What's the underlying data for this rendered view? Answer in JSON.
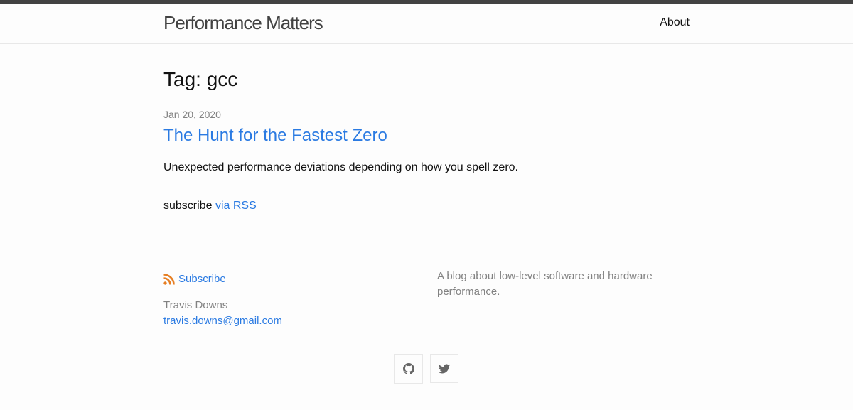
{
  "header": {
    "site_title": "Performance Matters",
    "nav_about": "About"
  },
  "main": {
    "page_heading": "Tag: gcc",
    "post": {
      "date": "Jan 20, 2020",
      "title": "The Hunt for the Fastest Zero",
      "excerpt": "Unexpected performance deviations depending on how you spell zero."
    },
    "subscribe_prefix": "subscribe",
    "subscribe_link": "via RSS"
  },
  "footer": {
    "subscribe_label": "Subscribe",
    "author_name": "Travis Downs",
    "author_email": "travis.downs@gmail.com",
    "description": "A blog about low-level software and hardware performance.",
    "social": [
      {
        "icon": "github-icon"
      },
      {
        "icon": "twitter-icon"
      }
    ]
  },
  "colors": {
    "link": "#2a7ae2",
    "rss": "#e67e22",
    "muted": "#828282",
    "topbar": "#424242"
  }
}
